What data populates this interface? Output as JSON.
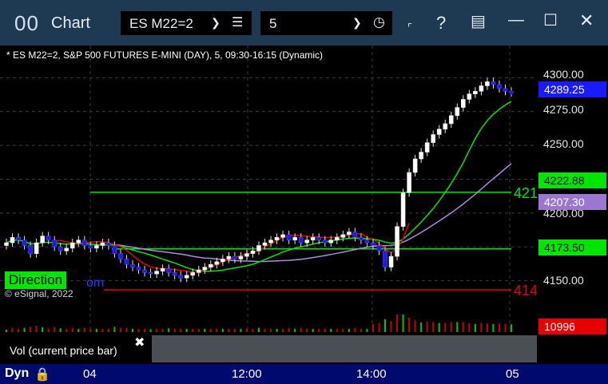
{
  "window": {
    "title": "Chart",
    "symbol": "ES M22=2",
    "interval": "5"
  },
  "chart": {
    "description": "* ES M22=2, S&P 500 FUTURES E-MINI (DAY), 5, 09:30-16:15 (Dynamic)",
    "watermark": "© eSignal, 2022",
    "direction_label": "Direction",
    "direction_tail": "om",
    "level_labels": {
      "green": "421",
      "red": "414"
    }
  },
  "price_axis": {
    "ticks": [
      "4300.00",
      "4275.00",
      "4250.00",
      "4200.00",
      "4150.00"
    ],
    "tags": [
      {
        "value": "4289.25",
        "color": "#1a1aff"
      },
      {
        "value": "4222.88",
        "color": "#00e600"
      },
      {
        "value": "4207.30",
        "color": "#9b77cf"
      },
      {
        "value": "4173.50",
        "color": "#00e600"
      },
      {
        "value": "10996",
        "color": "#e60000"
      }
    ]
  },
  "volume": {
    "caption": "Vol (current price bar)",
    "close_glyph": "✖"
  },
  "time_axis": {
    "mode": "Dyn",
    "labels": [
      "04",
      "12:00",
      "14:00",
      "05"
    ]
  },
  "chart_data": {
    "type": "candlestick",
    "title": "",
    "ylim": [
      4135,
      4312
    ],
    "levels": [
      {
        "price": 4215.3,
        "color": "#00e600"
      },
      {
        "price": 4173.5,
        "color": "#00e600"
      },
      {
        "price": 4143.2,
        "color": "#e60000"
      }
    ],
    "closes": [
      4178,
      4182,
      4180,
      4176,
      4170,
      4178,
      4183,
      4180,
      4175,
      4172,
      4174,
      4178,
      4180,
      4176,
      4174,
      4176,
      4178,
      4176,
      4170,
      4166,
      4162,
      4160,
      4158,
      4156,
      4155,
      4157,
      4159,
      4156,
      4154,
      4152,
      4154,
      4156,
      4158,
      4160,
      4162,
      4164,
      4166,
      4168,
      4166,
      4168,
      4170,
      4172,
      4176,
      4178,
      4180,
      4182,
      4184,
      4180,
      4182,
      4178,
      4180,
      4182,
      4180,
      4178,
      4180,
      4182,
      4184,
      4186,
      4182,
      4180,
      4178,
      4176,
      4172,
      4160,
      4168,
      4190,
      4215,
      4230,
      4240,
      4245,
      4252,
      4258,
      4262,
      4266,
      4272,
      4278,
      4284,
      4288,
      4290,
      4294,
      4297,
      4295,
      4292,
      4290,
      4289
    ]
  }
}
